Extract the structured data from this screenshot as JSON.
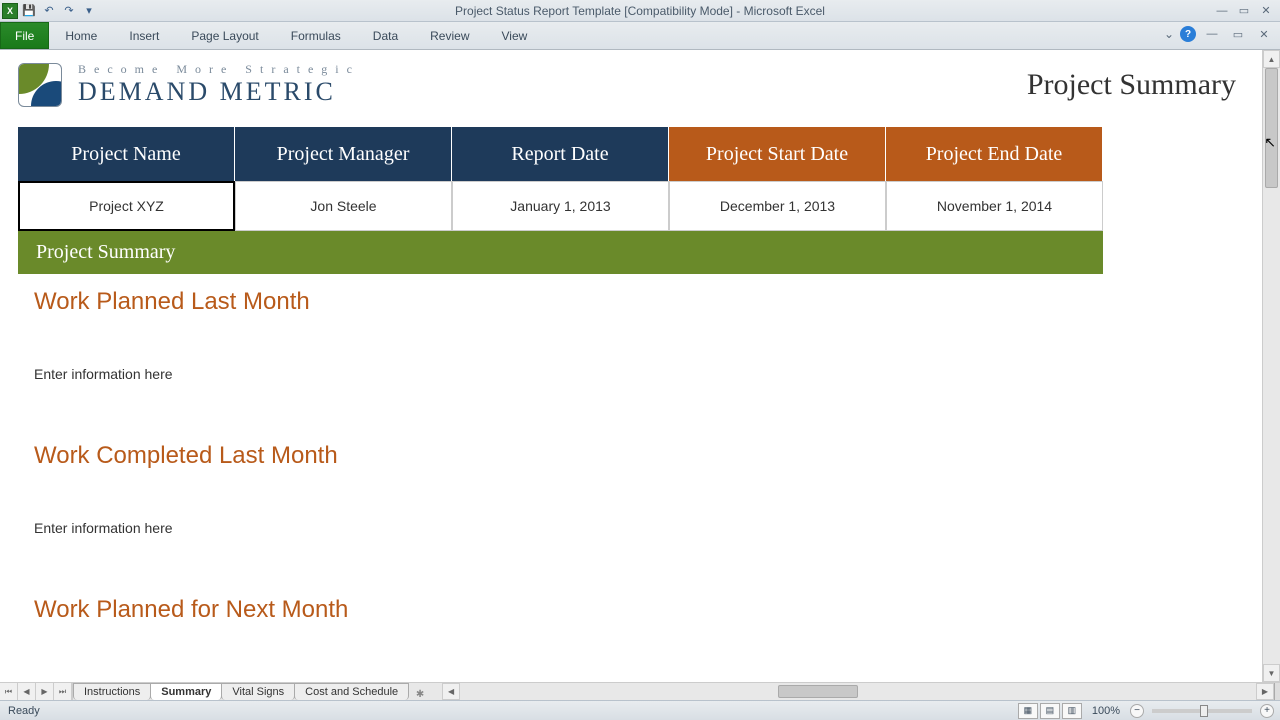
{
  "titlebar": {
    "title": "Project Status Report Template  [Compatibility Mode]  -  Microsoft Excel"
  },
  "ribbon": {
    "file": "File",
    "tabs": [
      "Home",
      "Insert",
      "Page Layout",
      "Formulas",
      "Data",
      "Review",
      "View"
    ]
  },
  "logo": {
    "tagline": "Become More Strategic",
    "brand": "DEMAND METRIC"
  },
  "page_title": "Project Summary",
  "project_table": {
    "headers": [
      {
        "label": "Project Name",
        "style": "blue"
      },
      {
        "label": "Project Manager",
        "style": "blue"
      },
      {
        "label": "Report Date",
        "style": "blue"
      },
      {
        "label": "Project Start Date",
        "style": "orange"
      },
      {
        "label": "Project End Date",
        "style": "orange"
      }
    ],
    "values": [
      "Project XYZ",
      "Jon Steele",
      "January 1, 2013",
      "December 1, 2013",
      "November 1, 2014"
    ]
  },
  "section_bar": "Project Summary",
  "sections": [
    {
      "heading": "Work Planned Last Month",
      "text": "Enter information here"
    },
    {
      "heading": "Work Completed Last Month",
      "text": "Enter information here"
    },
    {
      "heading": "Work Planned for Next Month",
      "text": ""
    }
  ],
  "sheet_tabs": [
    "Instructions",
    "Summary",
    "Vital Signs",
    "Cost and Schedule"
  ],
  "active_sheet": "Summary",
  "statusbar": {
    "ready": "Ready",
    "zoom": "100%"
  }
}
